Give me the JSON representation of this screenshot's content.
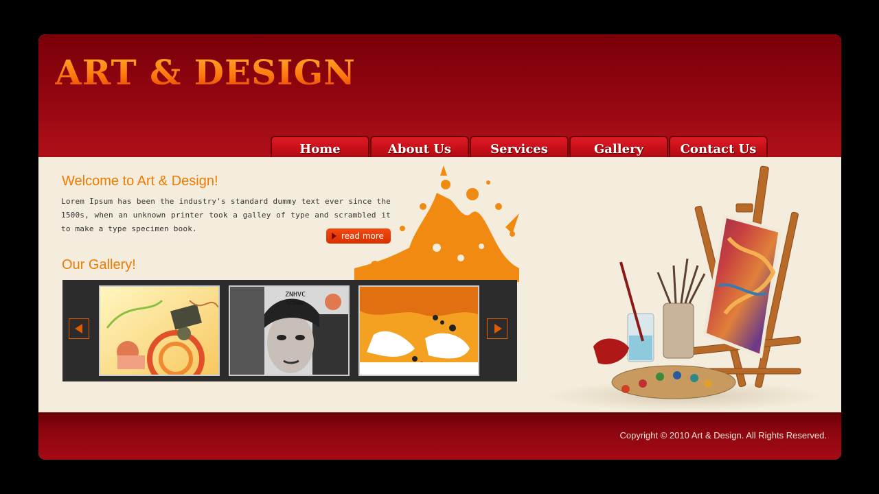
{
  "brand": {
    "logo_text": "ART & DESIGN"
  },
  "nav": {
    "items": [
      {
        "label": "Home"
      },
      {
        "label": "About Us"
      },
      {
        "label": "Services"
      },
      {
        "label": "Gallery"
      },
      {
        "label": "Contact Us"
      }
    ]
  },
  "welcome": {
    "title": "Welcome to Art & Design!",
    "body": "Lorem Ipsum has been the industry's standard dummy text ever since the 1500s, when an unknown printer took a galley of type and scrambled it to make a type specimen book.",
    "read_more_label": "read more"
  },
  "gallery": {
    "title": "Our Gallery!",
    "prev_icon": "arrow-left-icon",
    "next_icon": "arrow-right-icon",
    "thumbnails": [
      {
        "name": "abstract-collage"
      },
      {
        "name": "face-eye-chart"
      },
      {
        "name": "orange-paint-splash"
      }
    ]
  },
  "footer": {
    "copyright": "Copyright © 2010 Art & Design. All Rights Reserved."
  },
  "colors": {
    "header_red": "#a00810",
    "accent_orange": "#f07a00",
    "content_bg": "#f4ecdc",
    "gallery_bg": "#2c2c2c"
  }
}
